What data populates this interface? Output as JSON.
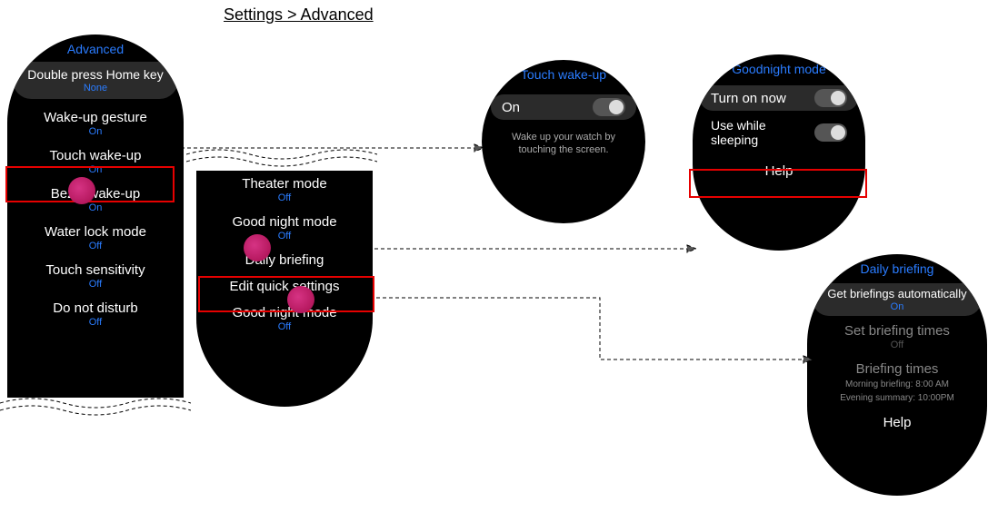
{
  "pageTitle": "Settings > Advanced",
  "advanced": {
    "title": "Advanced",
    "homekey": {
      "label": "Double press Home key",
      "status": "None"
    },
    "wakeGesture": {
      "label": "Wake-up gesture",
      "status": "On"
    },
    "touchWake": {
      "label": "Touch wake-up",
      "status": "On"
    },
    "bezelWake": {
      "label": "Bezel wake-up",
      "status": "On"
    },
    "waterLock": {
      "label": "Water lock mode",
      "status": "Off"
    },
    "touchSens": {
      "label": "Touch sensitivity",
      "status": "Off"
    },
    "dnd": {
      "label": "Do not disturb",
      "status": "Off"
    }
  },
  "advanced2": {
    "theater": {
      "label": "Theater mode",
      "status": "Off"
    },
    "goodnight": {
      "label": "Good night mode",
      "status": "Off"
    },
    "dailyBriefing": {
      "label": "Daily briefing"
    },
    "editQuick": {
      "label": "Edit quick settings"
    },
    "goodnight2": {
      "label": "Good night mode",
      "status": "Off"
    }
  },
  "touchWakeScreen": {
    "title": "Touch wake-up",
    "toggleLabel": "On",
    "desc": "Wake up your watch by touching the screen."
  },
  "goodnightScreen": {
    "title": "Goodnight mode",
    "turnOnNow": "Turn on now",
    "useWhileSleeping": "Use while sleeping",
    "help": "Help"
  },
  "dailyBriefingScreen": {
    "title": "Daily briefing",
    "auto": {
      "label": "Get briefings automatically",
      "status": "On"
    },
    "setTimes": {
      "label": "Set briefing times",
      "status": "Off"
    },
    "times": {
      "label": "Briefing times",
      "line1": "Morning briefing: 8:00 AM",
      "line2": "Evening summary: 10:00PM"
    },
    "help": "Help"
  }
}
